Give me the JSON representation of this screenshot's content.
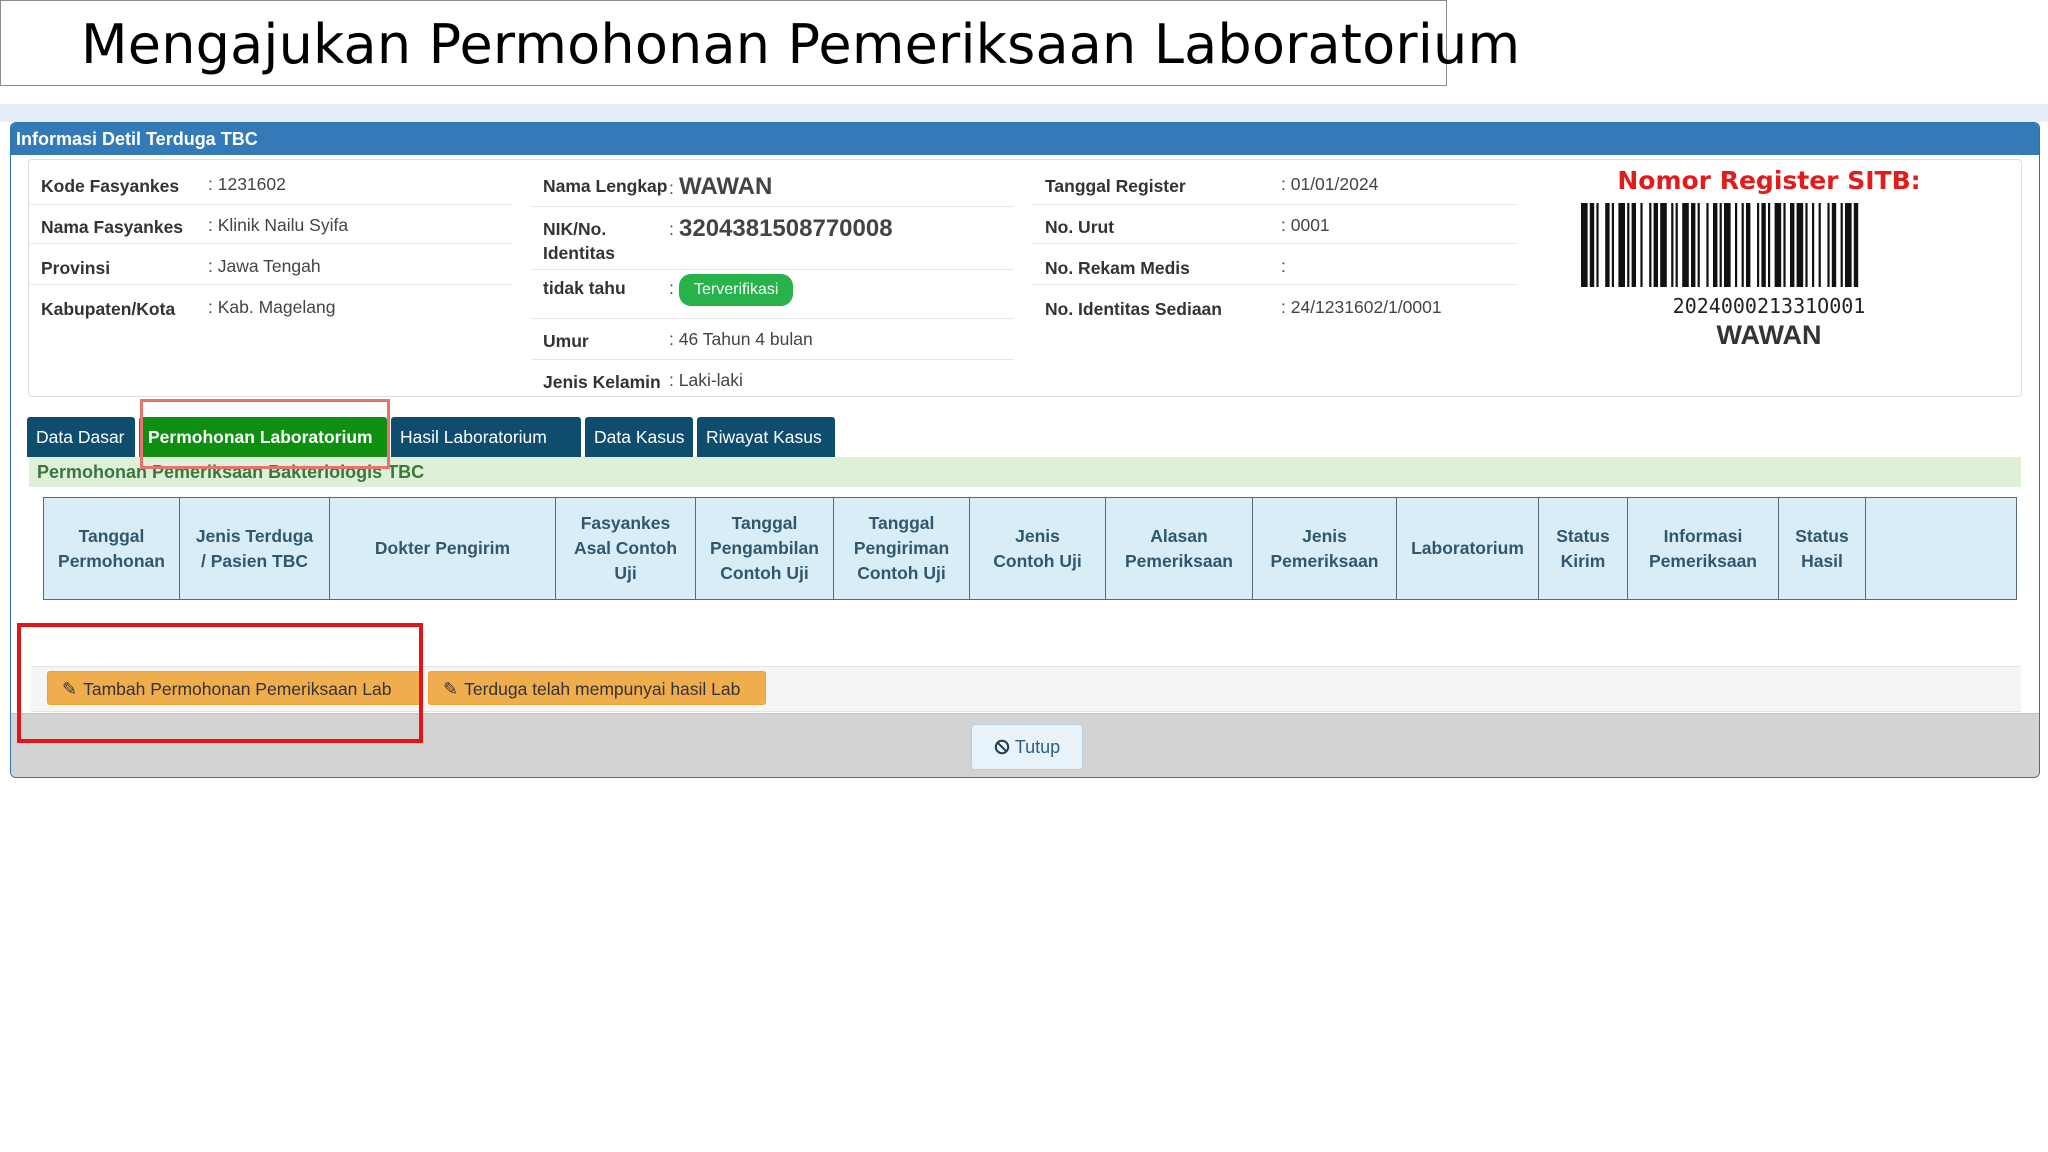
{
  "slide_title": "Mengajukan Permohonan Pemeriksaan Laboratorium",
  "modal": {
    "title": "Informasi Detil Terduga TBC"
  },
  "info_left": [
    {
      "label": "Kode Fasyankes",
      "value": "1231602"
    },
    {
      "label": "Nama Fasyankes",
      "value": "Klinik Nailu Syifa"
    },
    {
      "label": "Provinsi",
      "value": "Jawa Tengah"
    },
    {
      "label": "Kabupaten/Kota",
      "value": "Kab. Magelang"
    }
  ],
  "info_mid": {
    "nama_label": "Nama Lengkap",
    "nama_value": "WAWAN",
    "nik_label_1": "NIK/No.",
    "nik_label_2": "Identitas",
    "nik_value": "3204381508770008",
    "status_label": "tidak tahu",
    "status_badge": "Terverifikasi",
    "umur_label": "Umur",
    "umur_value": "46 Tahun 4 bulan",
    "jk_label": "Jenis Kelamin",
    "jk_value": "Laki-laki"
  },
  "info_right": [
    {
      "label": "Tanggal Register",
      "value": "01/01/2024"
    },
    {
      "label": "No. Urut",
      "value": "0001"
    },
    {
      "label": "No. Rekam Medis",
      "value": ""
    },
    {
      "label": "No. Identitas Sediaan",
      "value": "24/1231602/1/0001"
    }
  ],
  "sitb": {
    "title": "Nomor Register SITB:",
    "number": "202400021331O001",
    "name": "WAWAN"
  },
  "tabs": [
    {
      "label": "Data Dasar",
      "active": false
    },
    {
      "label": "Permohonan Laboratorium",
      "active": true
    },
    {
      "label": "Hasil Laboratorium",
      "active": false
    },
    {
      "label": "Data Kasus",
      "active": false
    },
    {
      "label": "Riwayat Kasus",
      "active": false
    }
  ],
  "section_title": "Permohonan Pemeriksaan Bakteriologis TBC",
  "table_headers": [
    [
      "Tanggal",
      "Permohonan"
    ],
    [
      "Jenis Terduga",
      "/ Pasien TBC"
    ],
    [
      "Dokter Pengirim"
    ],
    [
      "Fasyankes",
      "Asal Contoh",
      "Uji"
    ],
    [
      "Tanggal",
      "Pengambilan",
      "Contoh Uji"
    ],
    [
      "Tanggal",
      "Pengiriman",
      "Contoh Uji"
    ],
    [
      "Jenis",
      "Contoh Uji"
    ],
    [
      "Alasan",
      "Pemeriksaan"
    ],
    [
      "Jenis",
      "Pemeriksaan"
    ],
    [
      "Laboratorium"
    ],
    [
      "Status",
      "Kirim"
    ],
    [
      "Informasi",
      "Pemeriksaan"
    ],
    [
      "Status",
      "Hasil"
    ],
    [
      ""
    ]
  ],
  "actions": {
    "add_request": "Tambah Permohonan Pemeriksaan Lab",
    "has_result": "Terduga telah mempunyai hasil Lab"
  },
  "footer": {
    "close": "Tutup"
  },
  "colors": {
    "header_blue": "#337ab7",
    "tab_dark": "#0e4d6e",
    "tab_active": "#0f8f12",
    "badge_green": "#27b24a",
    "warning": "#f0ad4e",
    "highlight_red": "#e2151a"
  }
}
